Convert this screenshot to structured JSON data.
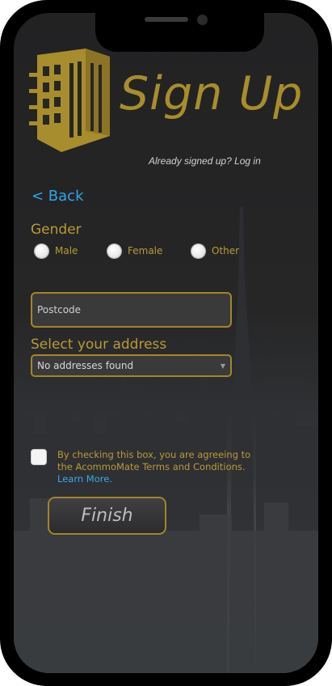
{
  "header": {
    "title": "Sign Up",
    "login_prompt": "Already signed up? Log in"
  },
  "nav": {
    "back_label": "< Back"
  },
  "gender": {
    "label": "Gender",
    "options": [
      "Male",
      "Female",
      "Other"
    ]
  },
  "postcode": {
    "placeholder": "Postcode",
    "value": ""
  },
  "address": {
    "label": "Select your address",
    "selected": "No addresses found"
  },
  "terms": {
    "text": "By checking this box, you are agreeing to the AcommoMate Terms and Conditions.",
    "link_text": "Learn More",
    "trailing": ".",
    "checked": false
  },
  "actions": {
    "finish_label": "Finish"
  },
  "colors": {
    "brand_gold": "#a88d2c",
    "link_blue": "#2fa6e8"
  },
  "icons": {
    "logo": "building-logo-icon",
    "caret": "chevron-down-icon"
  }
}
